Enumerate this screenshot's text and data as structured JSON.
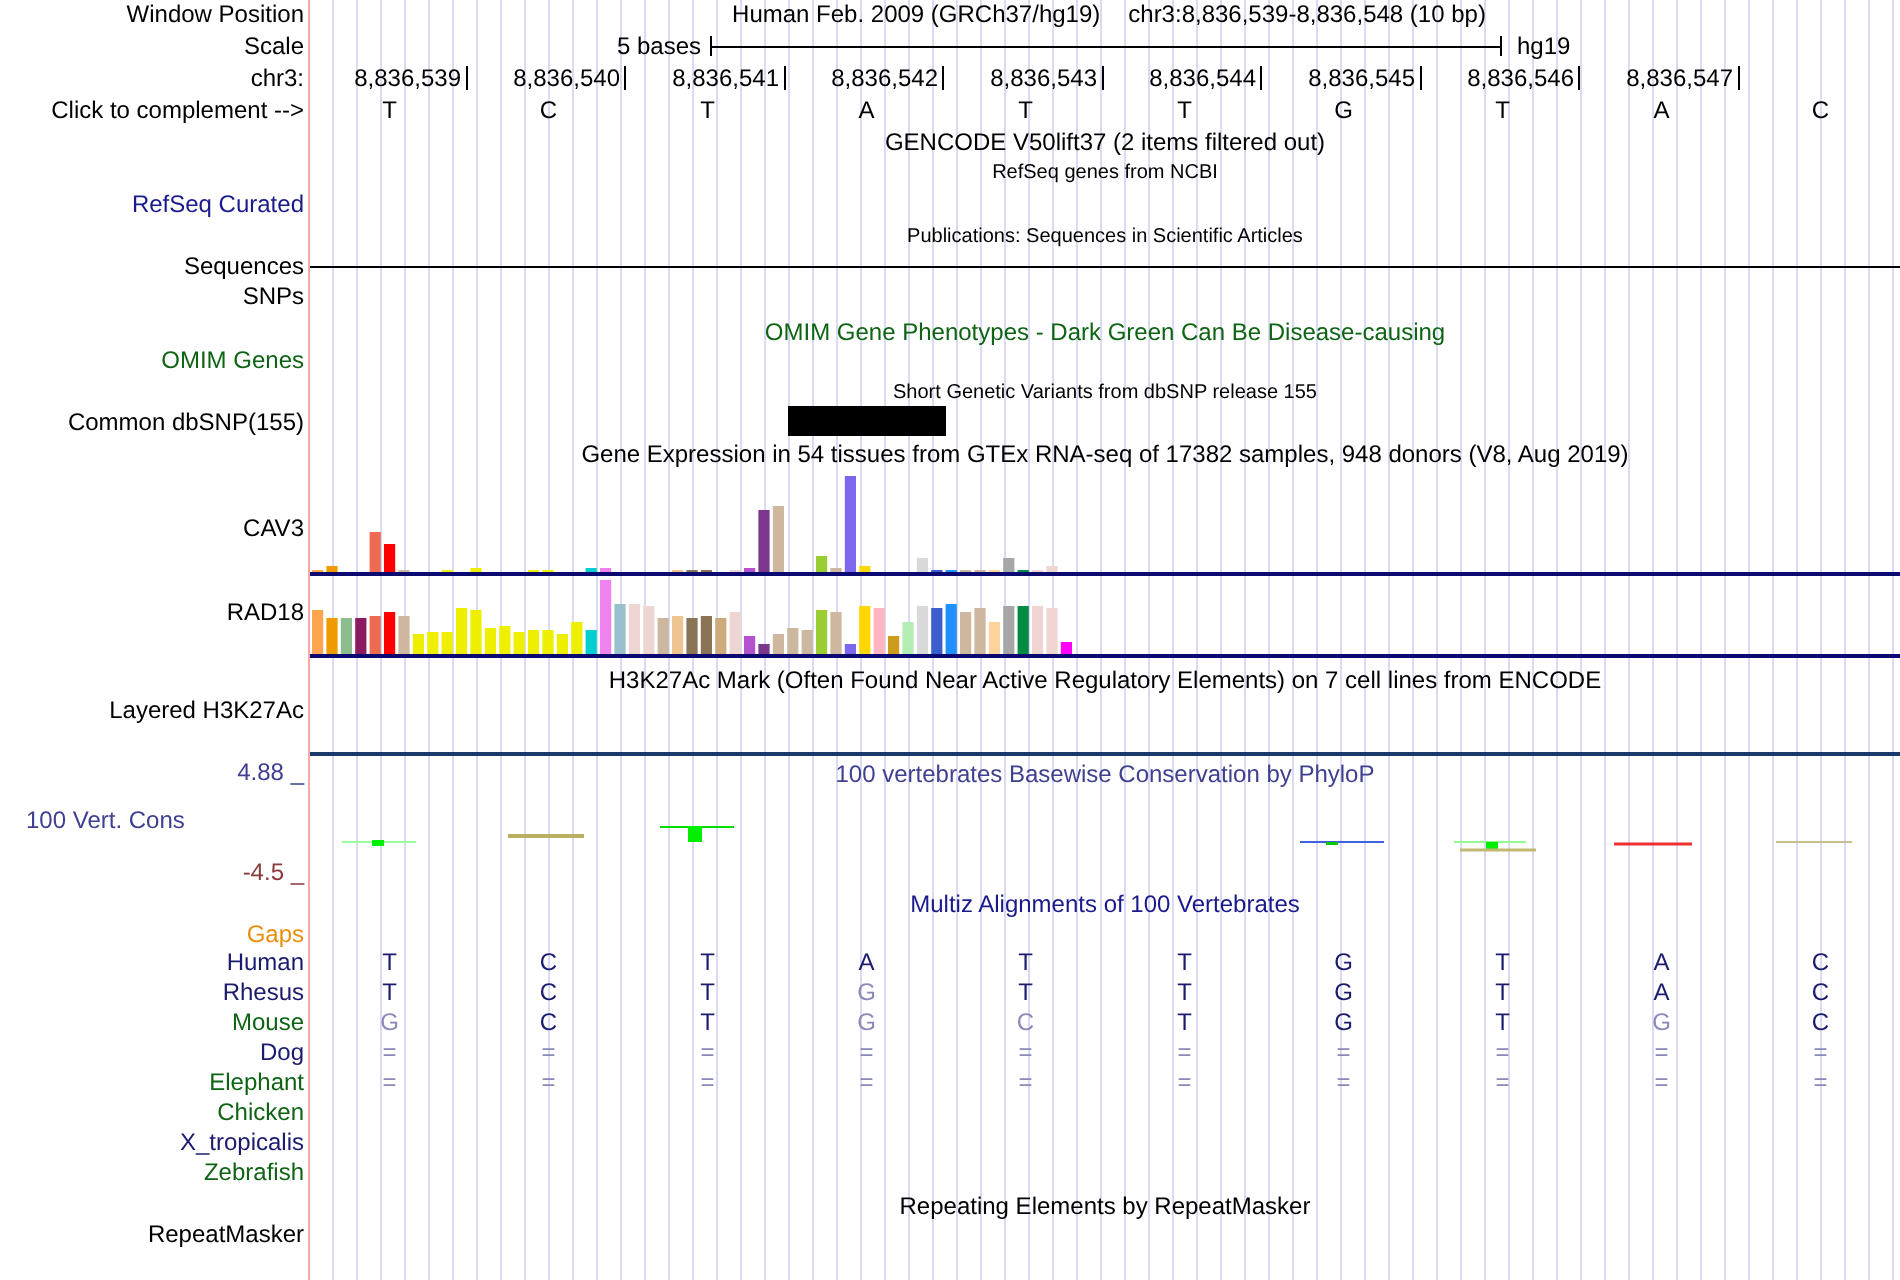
{
  "position": {
    "label": "Window Position",
    "assembly": "Human Feb. 2009 (GRCh37/hg19)",
    "range": "chr3:8,836,539-8,836,548 (10 bp)"
  },
  "scale": {
    "label": "Scale",
    "length": "5 bases",
    "assembly": "hg19"
  },
  "ruler": {
    "label": "chr3:",
    "positions": [
      "8,836,539",
      "8,836,540",
      "8,836,541",
      "8,836,542",
      "8,836,543",
      "8,836,544",
      "8,836,545",
      "8,836,546",
      "8,836,547"
    ]
  },
  "bases": {
    "label": "Click to complement -->",
    "letters": [
      "T",
      "C",
      "T",
      "A",
      "T",
      "T",
      "G",
      "T",
      "A",
      "C"
    ]
  },
  "gencode": {
    "title": "GENCODE V50lift37 (2 items filtered out)"
  },
  "refseq": {
    "title": "RefSeq genes from NCBI",
    "label": "RefSeq Curated"
  },
  "publications": {
    "title": "Publications: Sequences in Scientific Articles"
  },
  "sequences": {
    "label": "Sequences"
  },
  "snps": {
    "label": "SNPs"
  },
  "omim": {
    "title": "OMIM Gene Phenotypes - Dark Green Can Be Disease-causing",
    "label": "OMIM Genes"
  },
  "dbsnp": {
    "title": "Short Genetic Variants from dbSNP release 155",
    "label": "Common dbSNP(155)"
  },
  "gtex": {
    "title": "Gene Expression in 54 tissues from GTEx RNA-seq of 17382 samples, 948 donors (V8, Aug 2019)",
    "genes": [
      {
        "label": "CAV3"
      },
      {
        "label": "RAD18"
      }
    ]
  },
  "h3k27ac": {
    "title": "H3K27Ac Mark (Often Found Near Active Regulatory Elements) on 7 cell lines from ENCODE",
    "label": "Layered H3K27Ac"
  },
  "conservation": {
    "title": "100 vertebrates Basewise Conservation by PhyloP",
    "label": "100 Vert. Cons",
    "max": "4.88 _",
    "min": "-4.5 _"
  },
  "multiz": {
    "title": "Multiz Alignments of 100 Vertebrates",
    "gaps_label": "Gaps",
    "species": [
      {
        "name": "Human",
        "color": "#1a1a6e",
        "bases": [
          {
            "b": "T",
            "differs": false
          },
          {
            "b": "C",
            "differs": false
          },
          {
            "b": "T",
            "differs": false
          },
          {
            "b": "A",
            "differs": false
          },
          {
            "b": "T",
            "differs": false
          },
          {
            "b": "T",
            "differs": false
          },
          {
            "b": "G",
            "differs": false
          },
          {
            "b": "T",
            "differs": false
          },
          {
            "b": "A",
            "differs": false
          },
          {
            "b": "C",
            "differs": false
          }
        ]
      },
      {
        "name": "Rhesus",
        "color": "#1a1a6e",
        "bases": [
          {
            "b": "T",
            "differs": false
          },
          {
            "b": "C",
            "differs": false
          },
          {
            "b": "T",
            "differs": false
          },
          {
            "b": "G",
            "differs": true
          },
          {
            "b": "T",
            "differs": false
          },
          {
            "b": "T",
            "differs": false
          },
          {
            "b": "G",
            "differs": false
          },
          {
            "b": "T",
            "differs": false
          },
          {
            "b": "A",
            "differs": false
          },
          {
            "b": "C",
            "differs": false
          }
        ]
      },
      {
        "name": "Mouse",
        "color": "#0f6414",
        "bases": [
          {
            "b": "G",
            "differs": true
          },
          {
            "b": "C",
            "differs": false
          },
          {
            "b": "T",
            "differs": false
          },
          {
            "b": "G",
            "differs": true
          },
          {
            "b": "C",
            "differs": true
          },
          {
            "b": "T",
            "differs": false
          },
          {
            "b": "G",
            "differs": false
          },
          {
            "b": "T",
            "differs": false
          },
          {
            "b": "G",
            "differs": true
          },
          {
            "b": "C",
            "differs": false
          }
        ]
      },
      {
        "name": "Dog",
        "color": "#1a1a6e",
        "bases": [
          {
            "b": "=",
            "differs": true
          },
          {
            "b": "=",
            "differs": true
          },
          {
            "b": "=",
            "differs": true
          },
          {
            "b": "=",
            "differs": true
          },
          {
            "b": "=",
            "differs": true
          },
          {
            "b": "=",
            "differs": true
          },
          {
            "b": "=",
            "differs": true
          },
          {
            "b": "=",
            "differs": true
          },
          {
            "b": "=",
            "differs": true
          },
          {
            "b": "=",
            "differs": true
          }
        ]
      },
      {
        "name": "Elephant",
        "color": "#0f6414",
        "bases": [
          {
            "b": "=",
            "differs": true
          },
          {
            "b": "=",
            "differs": true
          },
          {
            "b": "=",
            "differs": true
          },
          {
            "b": "=",
            "differs": true
          },
          {
            "b": "=",
            "differs": true
          },
          {
            "b": "=",
            "differs": true
          },
          {
            "b": "=",
            "differs": true
          },
          {
            "b": "=",
            "differs": true
          },
          {
            "b": "=",
            "differs": true
          },
          {
            "b": "=",
            "differs": true
          }
        ]
      },
      {
        "name": "Chicken",
        "color": "#0f6414"
      },
      {
        "name": "X_tropicalis",
        "color": "#1a1a6e"
      },
      {
        "name": "Zebrafish",
        "color": "#0f6414"
      }
    ]
  },
  "repeatmasker": {
    "title": "Repeating Elements by RepeatMasker",
    "label": "RepeatMasker"
  }
}
